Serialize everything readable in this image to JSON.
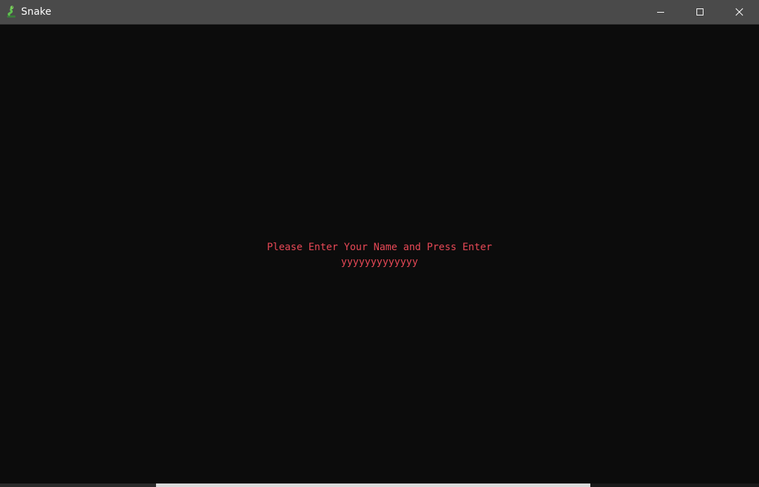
{
  "window": {
    "title": "Snake",
    "app_icon": "snake-icon",
    "controls": {
      "minimize_icon": "minimize-icon",
      "maximize_icon": "maximize-icon",
      "close_icon": "close-icon"
    }
  },
  "console": {
    "prompt": "Please Enter Your Name and Press Enter",
    "name_input": "yyyyyyyyyyyyy",
    "text_color": "#e74856",
    "background_color": "#0c0c0c"
  }
}
